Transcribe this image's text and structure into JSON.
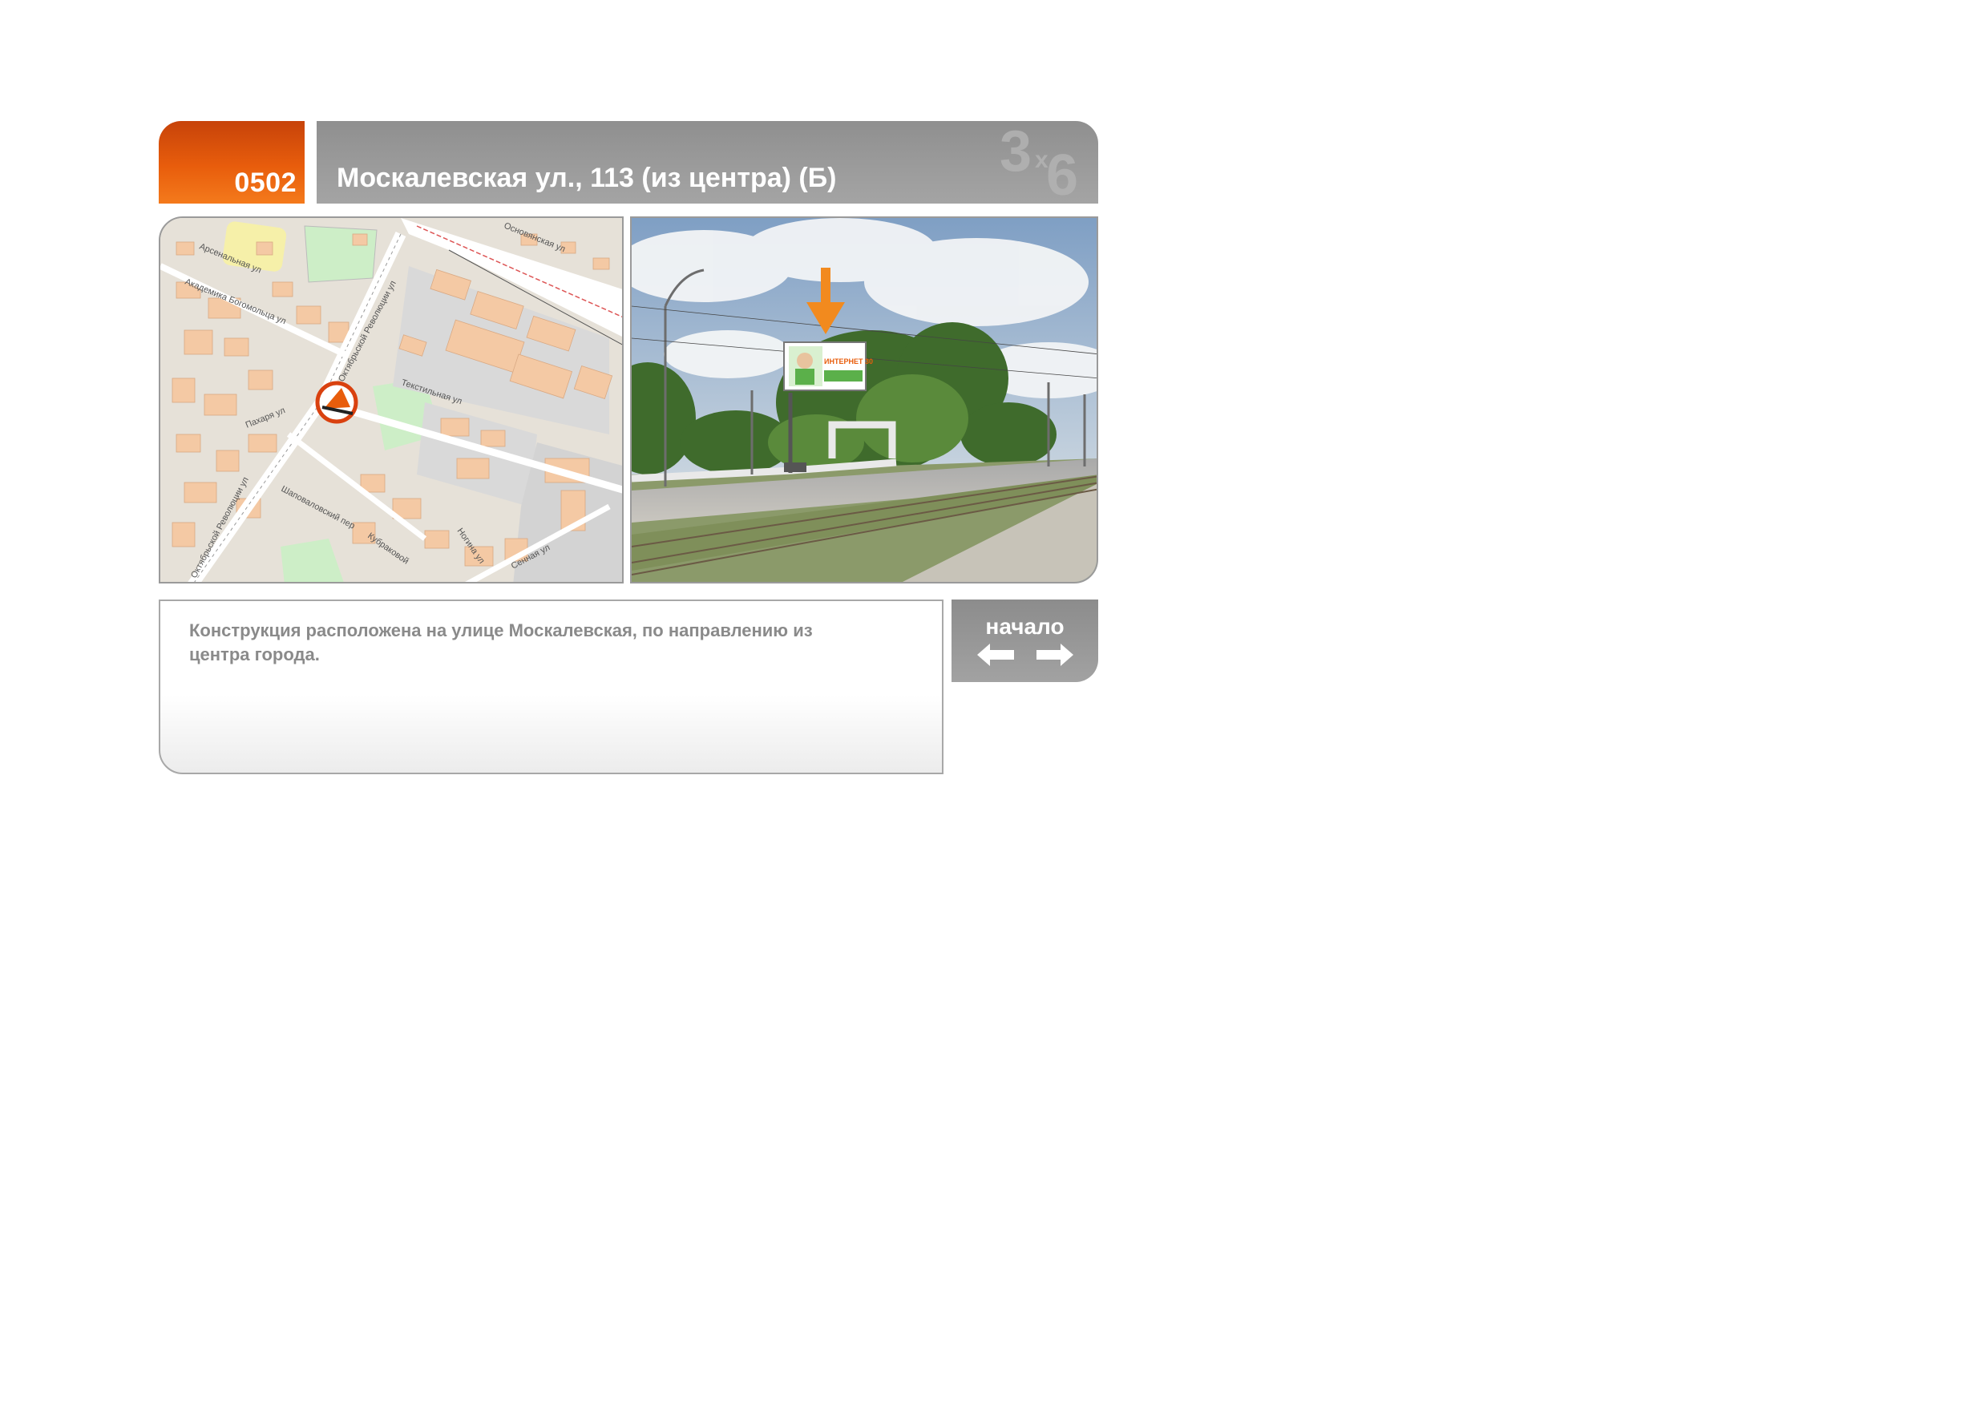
{
  "header": {
    "code": "0502",
    "title": "Москалевская ул., 113  (из центра)  (Б)",
    "brand": "3x6"
  },
  "map": {
    "streets": [
      "Арсенальная ул",
      "Академика Богомольца ул",
      "Октябрьской Революции ул",
      "Текстильная ул",
      "Пахаря ул",
      "Шаповаловский пер",
      "Кубраковой",
      "Основянская ул",
      "Октябрьской Революции ул",
      "Ногина ул",
      "Сенная ул"
    ],
    "marker_icon": "billboard-location-icon"
  },
  "photo": {
    "billboard_text": "ИНТЕРНЕТ 30",
    "pointer_icon": "down-arrow-icon"
  },
  "description": {
    "text": "Конструкция расположена на улице Москалевская, по направлению из центра города."
  },
  "navigation": {
    "label": "начало",
    "back_icon": "arrow-left-icon",
    "forward_icon": "arrow-right-icon"
  },
  "colors": {
    "accent_orange": "#e85d0c",
    "panel_gray": "#9c9c9c",
    "text_gray": "#8a8a8a"
  }
}
